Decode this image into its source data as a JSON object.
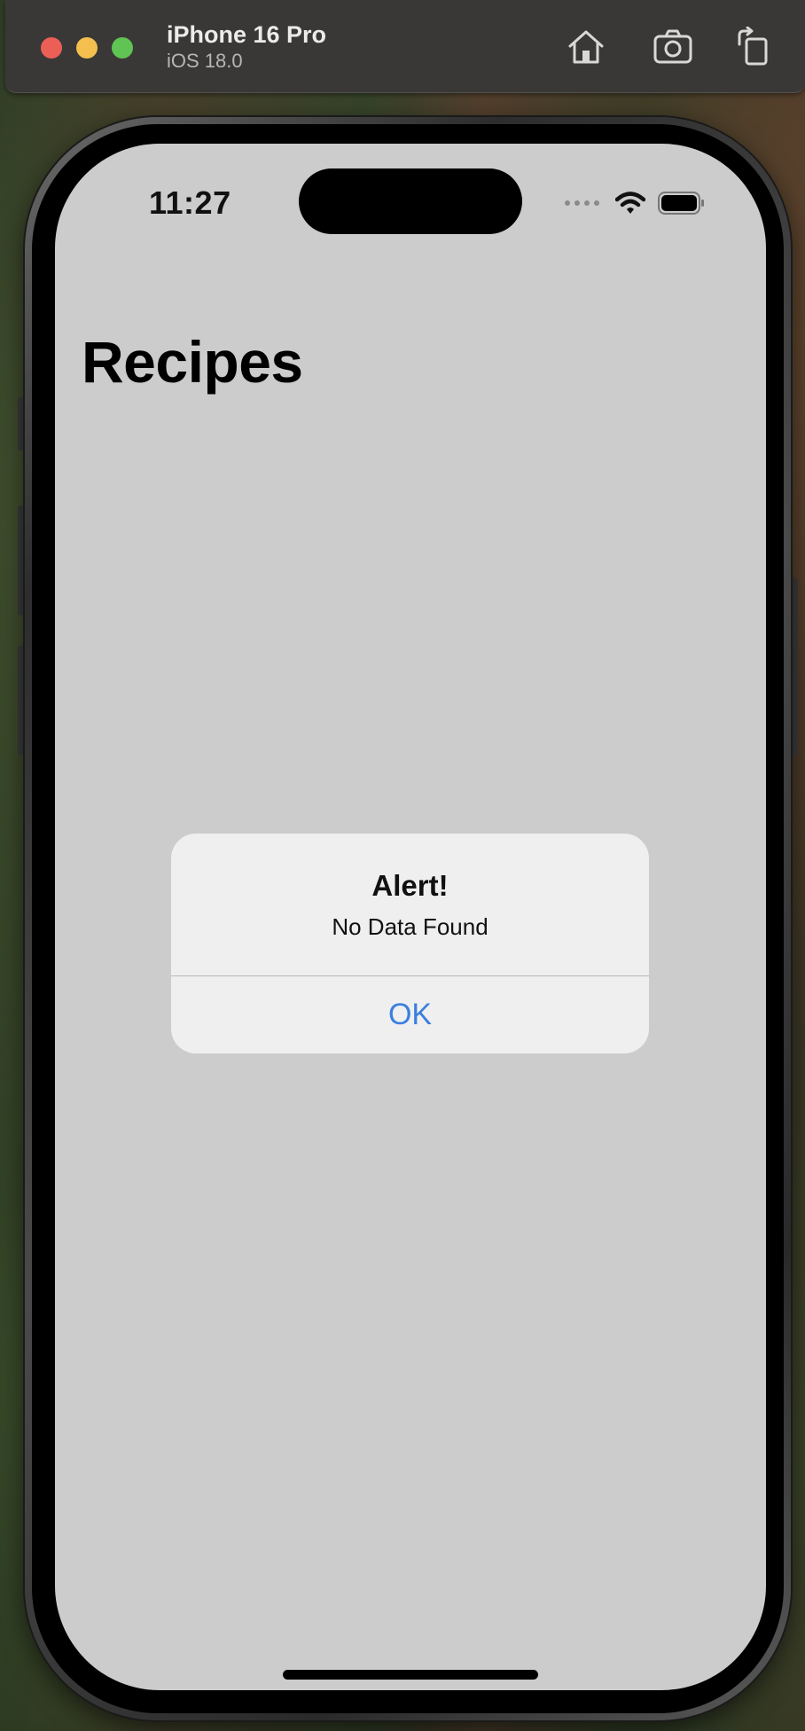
{
  "simulator": {
    "device_name": "iPhone 16 Pro",
    "os_version": "iOS 18.0",
    "toolbar_icons": [
      "home-icon",
      "screenshot-icon",
      "rotate-icon"
    ]
  },
  "status_bar": {
    "time": "11:27",
    "icons": [
      "cellular-signal-icon",
      "wifi-icon",
      "battery-icon"
    ]
  },
  "app": {
    "nav_title": "Recipes",
    "background_color": "#cccccc"
  },
  "alert": {
    "title": "Alert!",
    "message": "No Data Found",
    "button_label": "OK",
    "button_color": "#3a7ee0"
  }
}
